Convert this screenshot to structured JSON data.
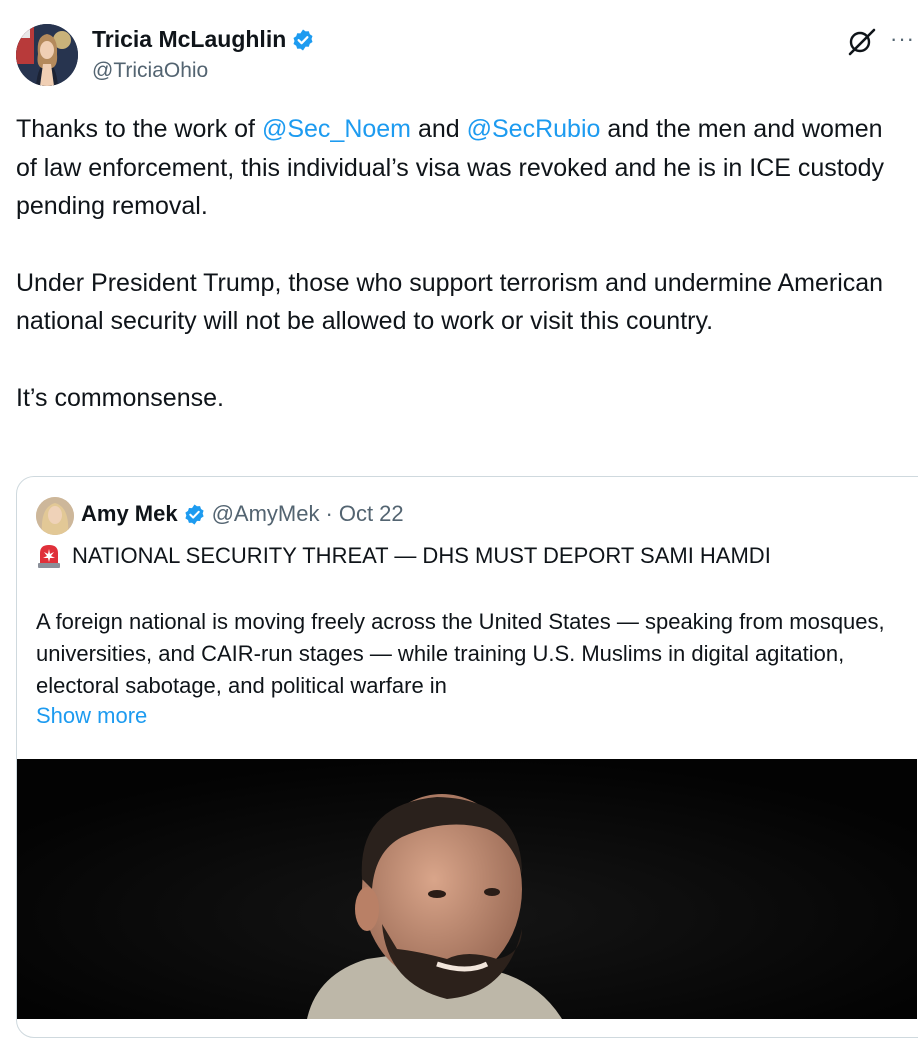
{
  "tweet": {
    "author_name": "Tricia McLaughlin",
    "author_handle": "@TriciaOhio",
    "more_label": "···",
    "paragraphs": [
      {
        "before": "Thanks to the work of ",
        "mention1": "@Sec_Noem",
        "middle": " and ",
        "mention2": "@SecRubio",
        "after": " and the men and women of law enforcement, this individual’s visa was revoked and he is in ICE custody pending removal."
      },
      "Under President Trump, those who support terrorism and undermine American national security will not be allowed to work or visit this country.",
      "It’s commonsense."
    ]
  },
  "quote": {
    "author_name": "Amy Mek",
    "author_handle": "@AmyMek",
    "separator": "·",
    "date": "Oct 22",
    "headline": "NATIONAL SECURITY THREAT — DHS MUST DEPORT SAMI HAMDI",
    "text": "A foreign national is moving freely across the United States — speaking from mosques, universities, and CAIR-run stages — while training U.S. Muslims in digital agitation, electoral sabotage, and political warfare in",
    "show_more": "Show more"
  },
  "icons": {
    "verified": "verified-badge-icon",
    "grok": "grok-icon",
    "siren": "police-light-emoji-icon"
  },
  "colors": {
    "link": "#1d9bf0",
    "text": "#0f1419",
    "secondary": "#536471",
    "border": "#cfd9de"
  }
}
